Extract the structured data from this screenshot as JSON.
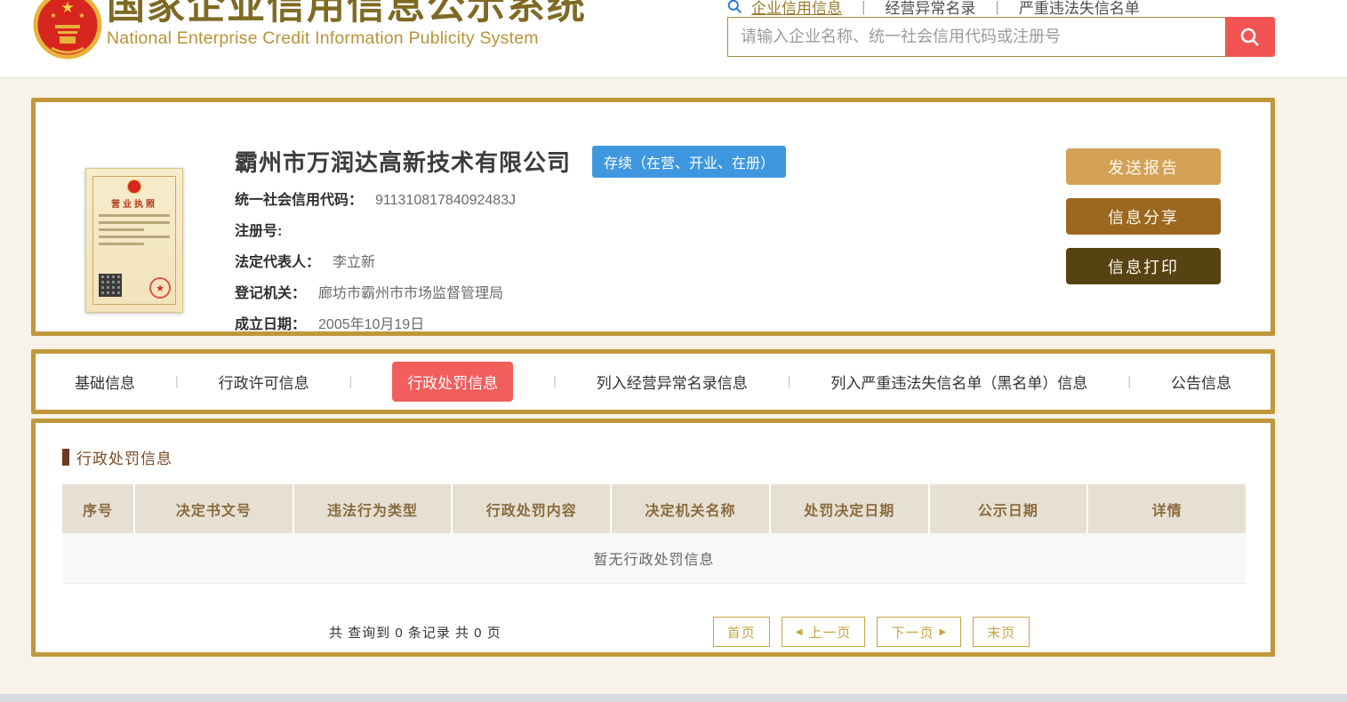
{
  "colors": {
    "gold_border": "#C0973B",
    "tab_active_red": "#F25D5D",
    "badge_blue": "#3E97DF",
    "btn_report_gold": "#D4A256",
    "btn_share_brown": "#9A681E",
    "btn_print_dark": "#574312",
    "title_olive": "#7E6A22",
    "subtitle_gold": "#B8933A",
    "table_header_bg": "#E6E0D3",
    "table_header_text": "#8A6B3E",
    "pager_gold": "#C9A53E",
    "search_btn_red": "#F25353"
  },
  "header": {
    "title_zh": "国家企业信用信息公示系统",
    "title_en": "National Enterprise Credit Information Publicity System",
    "nav": [
      {
        "label": "企业信用信息"
      },
      {
        "label": "经营异常名录"
      },
      {
        "label": "严重违法失信名单"
      }
    ],
    "nav_separator": "|",
    "search_placeholder": "请输入企业名称、统一社会信用代码或注册号"
  },
  "company": {
    "name": "霸州市万润达高新技术有限公司",
    "status": "存续（在营、开业、在册）",
    "license_title": "营业执照",
    "fields": [
      {
        "label": "统一社会信用代码：",
        "value": "91131081784092483J"
      },
      {
        "label": "注册号:",
        "value": ""
      },
      {
        "label": "法定代表人：",
        "value": "李立新"
      },
      {
        "label": "登记机关：",
        "value": "廊坊市霸州市市场监督管理局"
      },
      {
        "label": "成立日期：",
        "value": "2005年10月19日"
      }
    ],
    "actions": [
      {
        "label": "发送报告"
      },
      {
        "label": "信息分享"
      },
      {
        "label": "信息打印"
      }
    ]
  },
  "tabs": [
    {
      "label": "基础信息",
      "active": false
    },
    {
      "label": "行政许可信息",
      "active": false
    },
    {
      "label": "行政处罚信息",
      "active": true
    },
    {
      "label": "列入经营异常名录信息",
      "active": false
    },
    {
      "label": "列入严重违法失信名单（黑名单）信息",
      "active": false
    },
    {
      "label": "公告信息",
      "active": false
    }
  ],
  "penalty_section": {
    "title": "行政处罚信息",
    "table_headers": [
      "序号",
      "决定书文号",
      "违法行为类型",
      "行政处罚内容",
      "决定机关名称",
      "处罚决定日期",
      "公示日期",
      "详情"
    ],
    "empty_text": "暂无行政处罚信息",
    "summary": "共 查询到 0 条记录 共 0 页",
    "pagination": {
      "first": "首页",
      "prev": "上一页",
      "next": "下一页",
      "last": "末页",
      "prev_arrow": "◀",
      "next_arrow": "▶"
    }
  }
}
